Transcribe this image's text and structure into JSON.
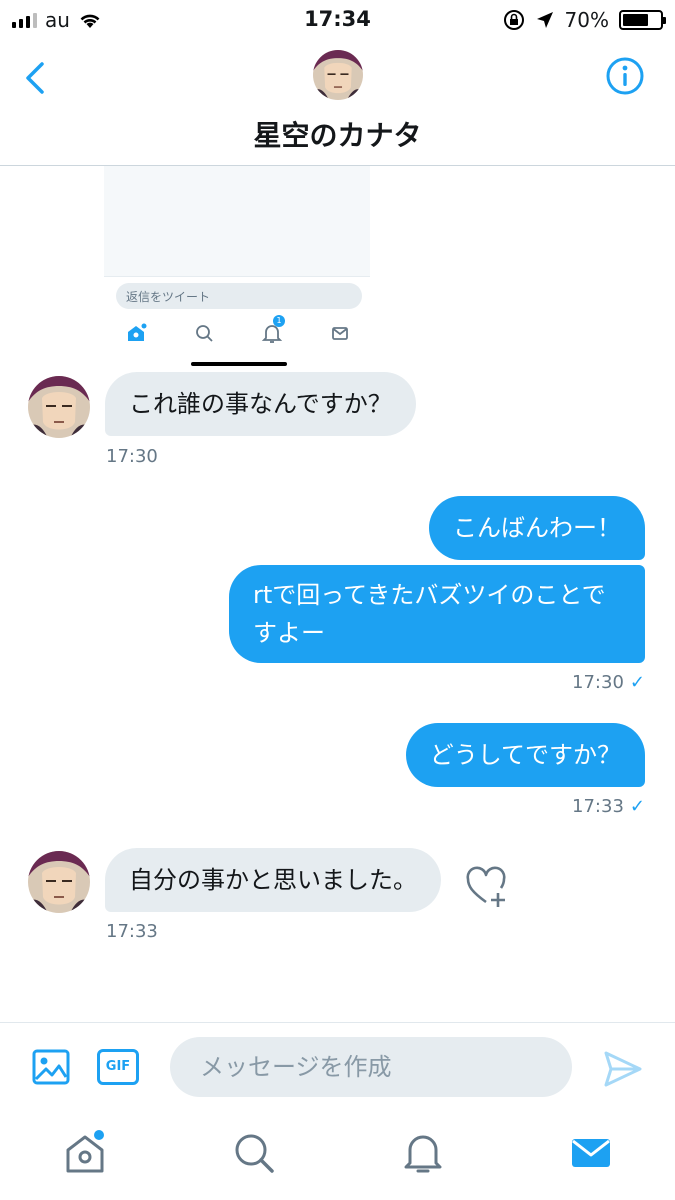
{
  "status_bar": {
    "carrier": "au",
    "time": "17:34",
    "battery_pct": "70%",
    "battery_level": 0.7
  },
  "header": {
    "title": "星空のカナタ",
    "back_icon": "chevron-left-icon",
    "info_icon": "info-icon"
  },
  "shared_image": {
    "reply_placeholder": "返信をツイート",
    "notification_badge": "1",
    "nav_icons": [
      "home-icon",
      "search-icon",
      "bell-icon",
      "mail-icon"
    ]
  },
  "messages": [
    {
      "id": "m1",
      "direction": "in",
      "text": "これ誰の事なんですか？",
      "time": "17:30"
    },
    {
      "id": "m2",
      "direction": "out",
      "text": "こんばんわー！"
    },
    {
      "id": "m3",
      "direction": "out",
      "text": "rtで回ってきたバズツイのことですよー",
      "time": "17:30"
    },
    {
      "id": "m4",
      "direction": "out",
      "text": "どうしてですか？",
      "time": "17:33"
    },
    {
      "id": "m5",
      "direction": "in",
      "text": "自分の事かと思いました。",
      "time": "17:33"
    }
  ],
  "read_mark": "✓",
  "composer": {
    "placeholder": "メッセージを作成",
    "gif_label": "GIF"
  },
  "tabbar": {
    "items": [
      "home-icon",
      "search-icon",
      "notifications-icon",
      "messages-icon"
    ],
    "active": "messages-icon"
  },
  "colors": {
    "accent": "#1da1f2",
    "incoming_bubble": "#e6ecf0",
    "secondary_text": "#657786"
  }
}
